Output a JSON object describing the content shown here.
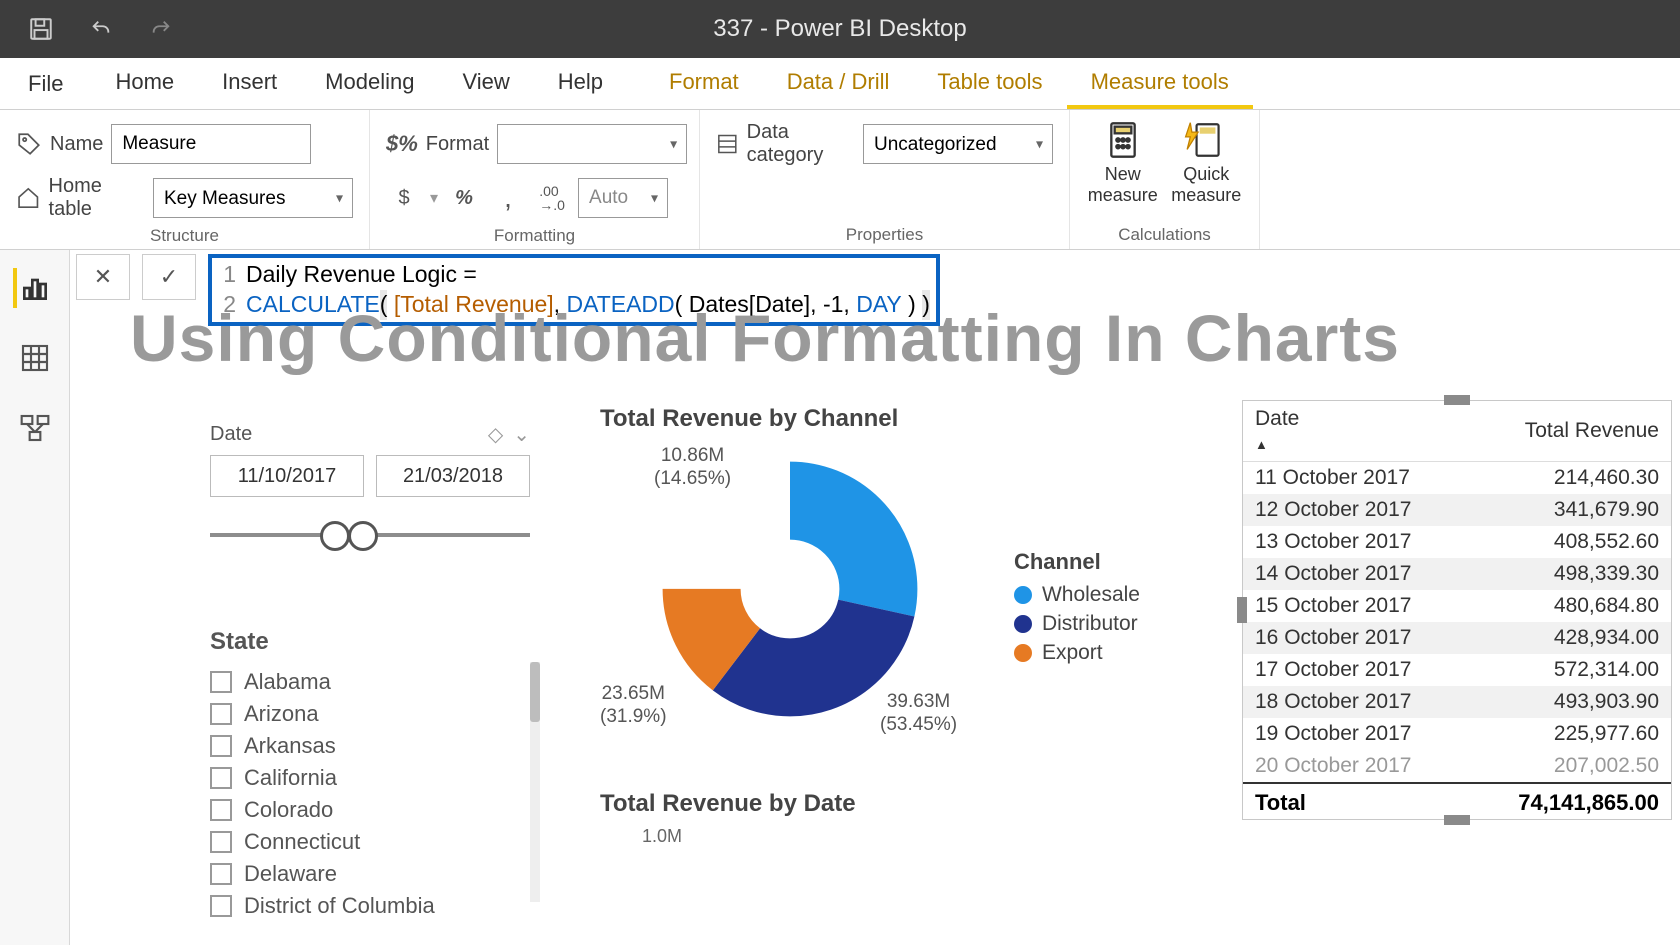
{
  "app_title": "337 - Power BI Desktop",
  "menu": {
    "file": "File",
    "tabs": [
      "Home",
      "Insert",
      "Modeling",
      "View",
      "Help"
    ],
    "contextual": [
      "Format",
      "Data / Drill",
      "Table tools",
      "Measure tools"
    ],
    "active": "Measure tools"
  },
  "ribbon": {
    "structure": {
      "label": "Structure",
      "name_label": "Name",
      "name_value": "Measure",
      "home_label": "Home table",
      "home_value": "Key Measures"
    },
    "formatting": {
      "label": "Formatting",
      "format_label": "Format",
      "format_value": "",
      "currency": "$",
      "percent": "%",
      "comma": ",",
      "decimals": ".00",
      "auto": "Auto"
    },
    "properties": {
      "label": "Properties",
      "cat_label": "Data category",
      "cat_value": "Uncategorized"
    },
    "calculations": {
      "label": "Calculations",
      "new_measure": "New\nmeasure",
      "quick_measure": "Quick\nmeasure"
    }
  },
  "formula": {
    "line1": "Daily Revenue Logic =",
    "calc": "CALCULATE",
    "ref": "[Total Revenue]",
    "dateadd": "DATEADD",
    "datecol": "Dates[Date]",
    "num": "-1",
    "day": "DAY"
  },
  "page_heading": "Using Conditional Formatting In Charts",
  "slicer_date": {
    "title": "Date",
    "from": "11/10/2017",
    "to": "21/03/2018"
  },
  "slicer_state": {
    "title": "State",
    "items": [
      "Alabama",
      "Arizona",
      "Arkansas",
      "California",
      "Colorado",
      "Connecticut",
      "Delaware",
      "District of Columbia"
    ]
  },
  "donut": {
    "title": "Total Revenue by Channel",
    "legend_title": "Channel",
    "legend": [
      {
        "name": "Wholesale",
        "color": "#1f94e6"
      },
      {
        "name": "Distributor",
        "color": "#20338f"
      },
      {
        "name": "Export",
        "color": "#e67a23"
      }
    ],
    "labels": {
      "wholesale": {
        "value": "39.63M",
        "pct": "(53.45%)"
      },
      "distributor": {
        "value": "23.65M",
        "pct": "(31.9%)"
      },
      "export": {
        "value": "10.86M",
        "pct": "(14.65%)"
      }
    }
  },
  "line": {
    "title": "Total Revenue by Date",
    "y_tick": "1.0M"
  },
  "table": {
    "headers": [
      "Date",
      "Total Revenue"
    ],
    "rows": [
      [
        "11 October 2017",
        "214,460.30"
      ],
      [
        "12 October 2017",
        "341,679.90"
      ],
      [
        "13 October 2017",
        "408,552.60"
      ],
      [
        "14 October 2017",
        "498,339.30"
      ],
      [
        "15 October 2017",
        "480,684.80"
      ],
      [
        "16 October 2017",
        "428,934.00"
      ],
      [
        "17 October 2017",
        "572,314.00"
      ],
      [
        "18 October 2017",
        "493,903.90"
      ],
      [
        "19 October 2017",
        "225,977.60"
      ]
    ],
    "cut_row": [
      "20 October 2017",
      "207,002.50"
    ],
    "total_label": "Total",
    "total_value": "74,141,865.00"
  },
  "chart_data": {
    "type": "pie",
    "title": "Total Revenue by Channel",
    "series": [
      {
        "name": "Wholesale",
        "value": 39.63,
        "pct": 53.45,
        "color": "#1f94e6"
      },
      {
        "name": "Distributor",
        "value": 23.65,
        "pct": 31.9,
        "color": "#20338f"
      },
      {
        "name": "Export",
        "value": 10.86,
        "pct": 14.65,
        "color": "#e67a23"
      }
    ],
    "unit": "M"
  }
}
